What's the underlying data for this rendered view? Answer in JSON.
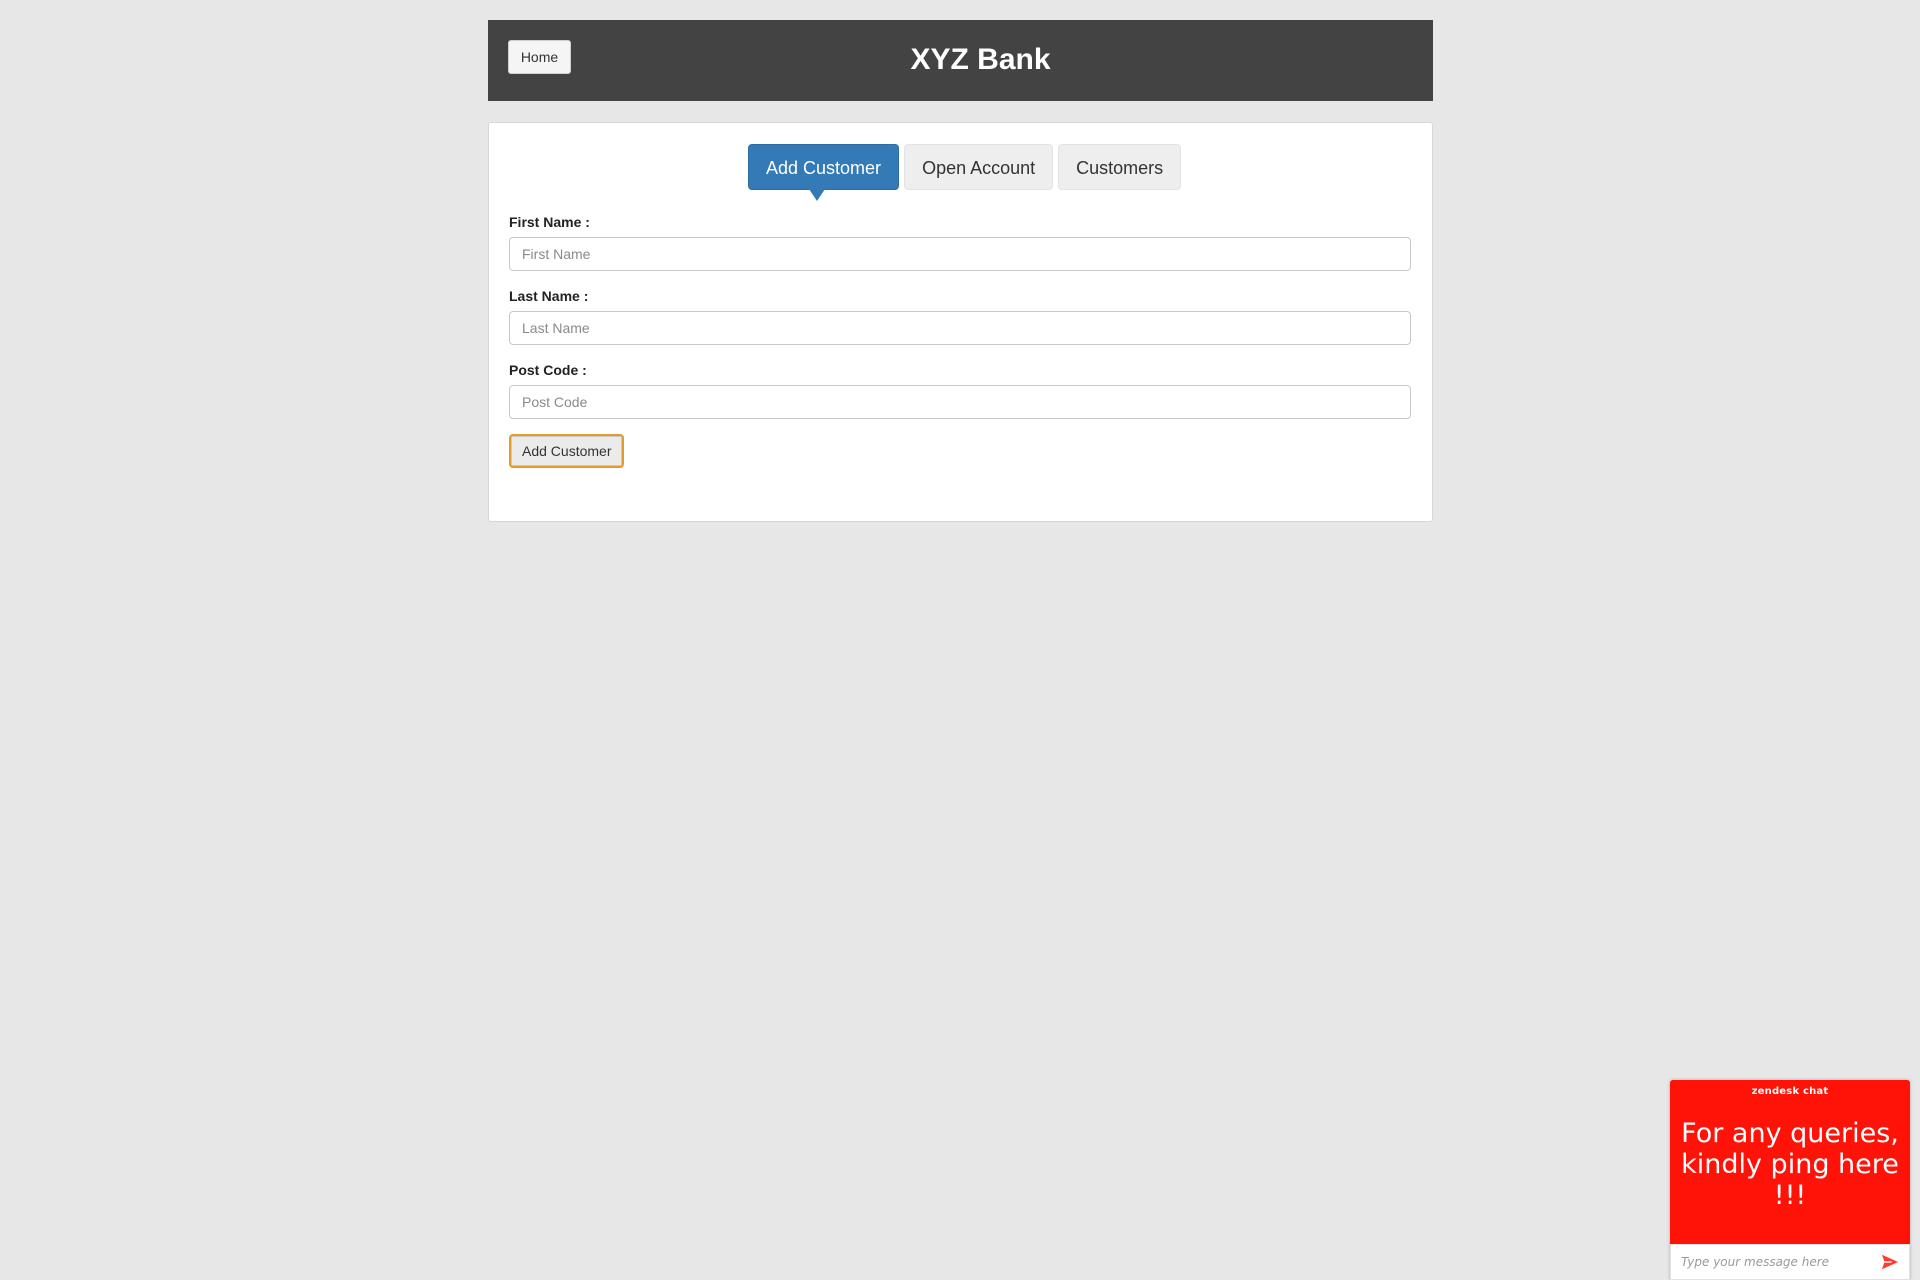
{
  "header": {
    "home_label": "Home",
    "title": "XYZ Bank"
  },
  "tabs": [
    {
      "label": "Add Customer",
      "active": true
    },
    {
      "label": "Open Account",
      "active": false
    },
    {
      "label": "Customers",
      "active": false
    }
  ],
  "form": {
    "first_name": {
      "label": "First Name :",
      "placeholder": "First Name",
      "value": ""
    },
    "last_name": {
      "label": "Last Name :",
      "placeholder": "Last Name",
      "value": ""
    },
    "post_code": {
      "label": "Post Code :",
      "placeholder": "Post Code",
      "value": ""
    },
    "submit_label": "Add Customer"
  },
  "chat": {
    "brand": "zendesk chat",
    "message": "For any queries, kindly ping here !!!",
    "input_placeholder": "Type your message here",
    "send_icon": "send-icon",
    "color": "#ff1208"
  },
  "colors": {
    "header_bg": "#434343",
    "active_tab": "#337ab7",
    "focus_ring": "#e39c2c",
    "page_bg": "#e7e7e7"
  }
}
